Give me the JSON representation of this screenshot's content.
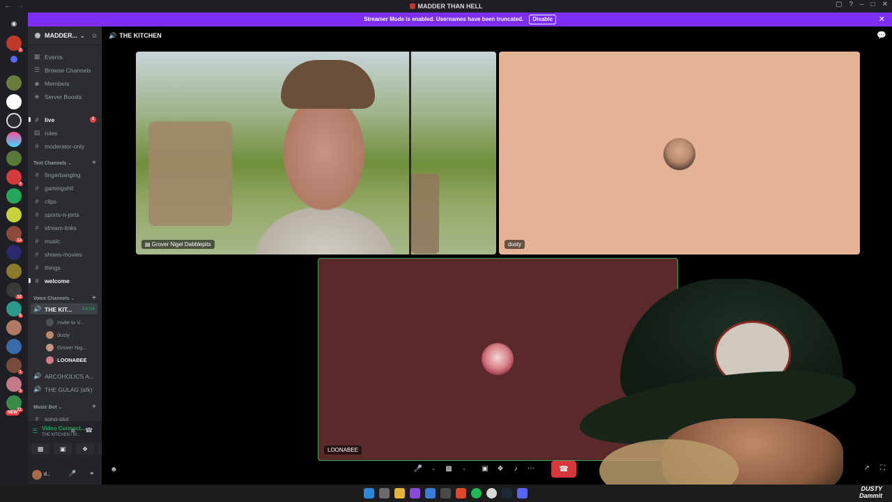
{
  "window": {
    "title": "MADDER THAN HELL"
  },
  "banner": {
    "text": "Streamer Mode is enabled. Usernames have been truncated.",
    "button": "Disable"
  },
  "server": {
    "name": "MADDER..."
  },
  "nav": [
    {
      "label": "Events",
      "icon": "calendar-icon"
    },
    {
      "label": "Browse Channels",
      "icon": "list-icon"
    },
    {
      "label": "Members",
      "icon": "members-icon"
    },
    {
      "label": "Server Boosts",
      "icon": "boost-icon"
    }
  ],
  "top_channels": [
    {
      "label": "live",
      "unread": true,
      "mentions": "2"
    },
    {
      "label": "rules"
    },
    {
      "label": "moderator-only"
    }
  ],
  "text_category": "Text Channels",
  "text_channels": [
    "fingerbanging",
    "gamingshit",
    "clips",
    "sports-n-jorts",
    "stream-links",
    "music",
    "shows-movies",
    "things",
    "welcome"
  ],
  "voice_category": "Voice Channels",
  "voice_channels": {
    "active": {
      "label": "THE KIT...",
      "timer": "24:04"
    },
    "members": [
      {
        "label": "Invite to V...",
        "color": "#4e5058"
      },
      {
        "label": "dusty",
        "color": "#b98a6c"
      },
      {
        "label": "Grover Nig...",
        "color": "#c69482"
      },
      {
        "label": "LOONABEE",
        "color": "#d47c86"
      }
    ],
    "others": [
      "ARCOHOLICS A...",
      "THE GULAG (afk)"
    ]
  },
  "music_category": "Music Bot",
  "music_channel": "song-slut",
  "voice_panel": {
    "status": "Video Connect...",
    "location": "THE KITCHEN / M..."
  },
  "user": {
    "name": "d..."
  },
  "call": {
    "channel": "THE KITCHEN",
    "tiles": {
      "cam": "Grover Nigel Dabblepits",
      "dusty": "dusty",
      "loona": "LOONABEE"
    }
  },
  "rail_badges": [
    "2",
    "4",
    "13",
    "12",
    "5",
    "1",
    "3",
    "11"
  ],
  "rail_new": "NEW",
  "watermark": [
    "DUSTY",
    "Dammit"
  ],
  "colors": {
    "brand": "#5865f2",
    "online": "#23a55a",
    "danger": "#da373c",
    "banner": "#7b2ff7"
  }
}
